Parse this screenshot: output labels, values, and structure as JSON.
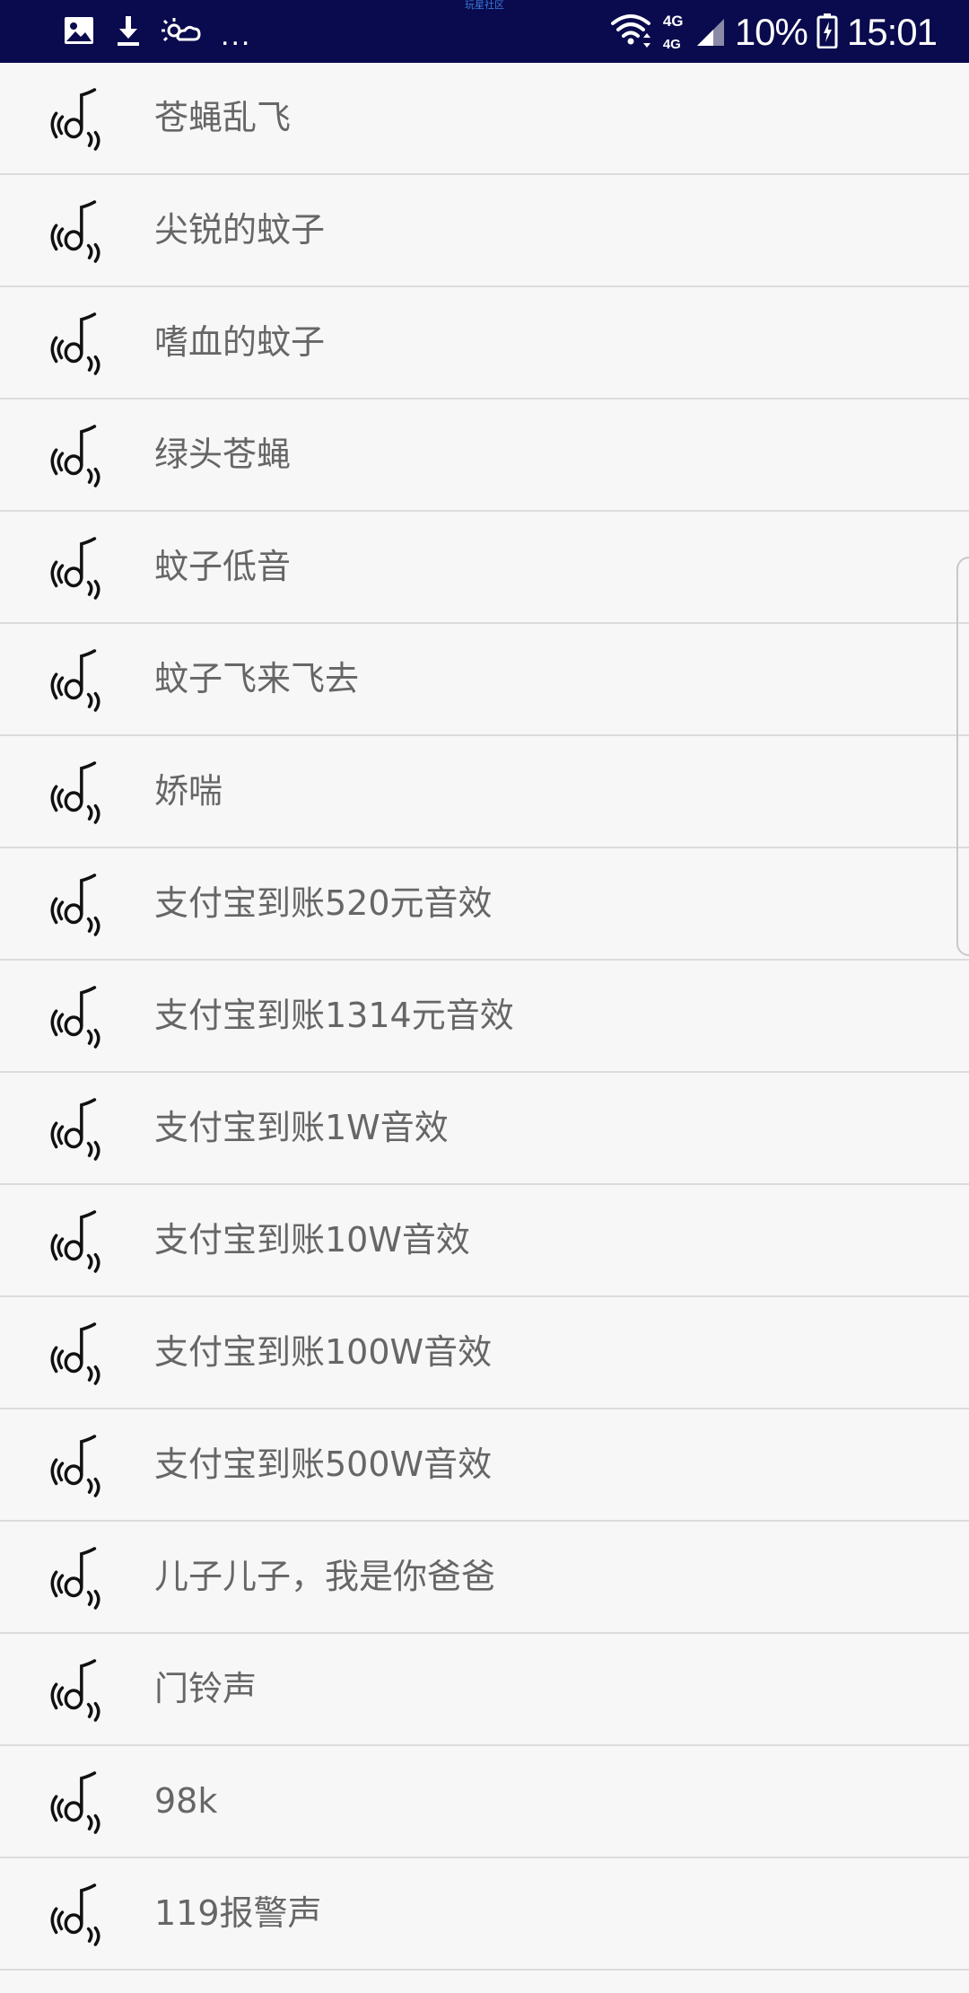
{
  "status_bar": {
    "center_text": "玩星社区",
    "network_top": "4G",
    "network_bottom": "4G",
    "battery": "10%",
    "time": "15:01",
    "overflow_dots": "...",
    "icons": [
      "image-icon",
      "download-icon",
      "weather-icon",
      "wifi-icon",
      "signal-icon",
      "battery-icon"
    ]
  },
  "list_icon": "sound-note-icon",
  "items": [
    {
      "label": "苍蝇乱飞"
    },
    {
      "label": "尖锐的蚊子"
    },
    {
      "label": "嗜血的蚊子"
    },
    {
      "label": "绿头苍蝇"
    },
    {
      "label": "蚊子低音"
    },
    {
      "label": "蚊子飞来飞去"
    },
    {
      "label": "娇喘"
    },
    {
      "label": "支付宝到账520元音效"
    },
    {
      "label": "支付宝到账1314元音效"
    },
    {
      "label": "支付宝到账1W音效"
    },
    {
      "label": "支付宝到账10W音效"
    },
    {
      "label": "支付宝到账100W音效"
    },
    {
      "label": "支付宝到账500W音效"
    },
    {
      "label": "儿子儿子，我是你爸爸"
    },
    {
      "label": "门铃声"
    },
    {
      "label": "98k"
    },
    {
      "label": "119报警声"
    }
  ]
}
